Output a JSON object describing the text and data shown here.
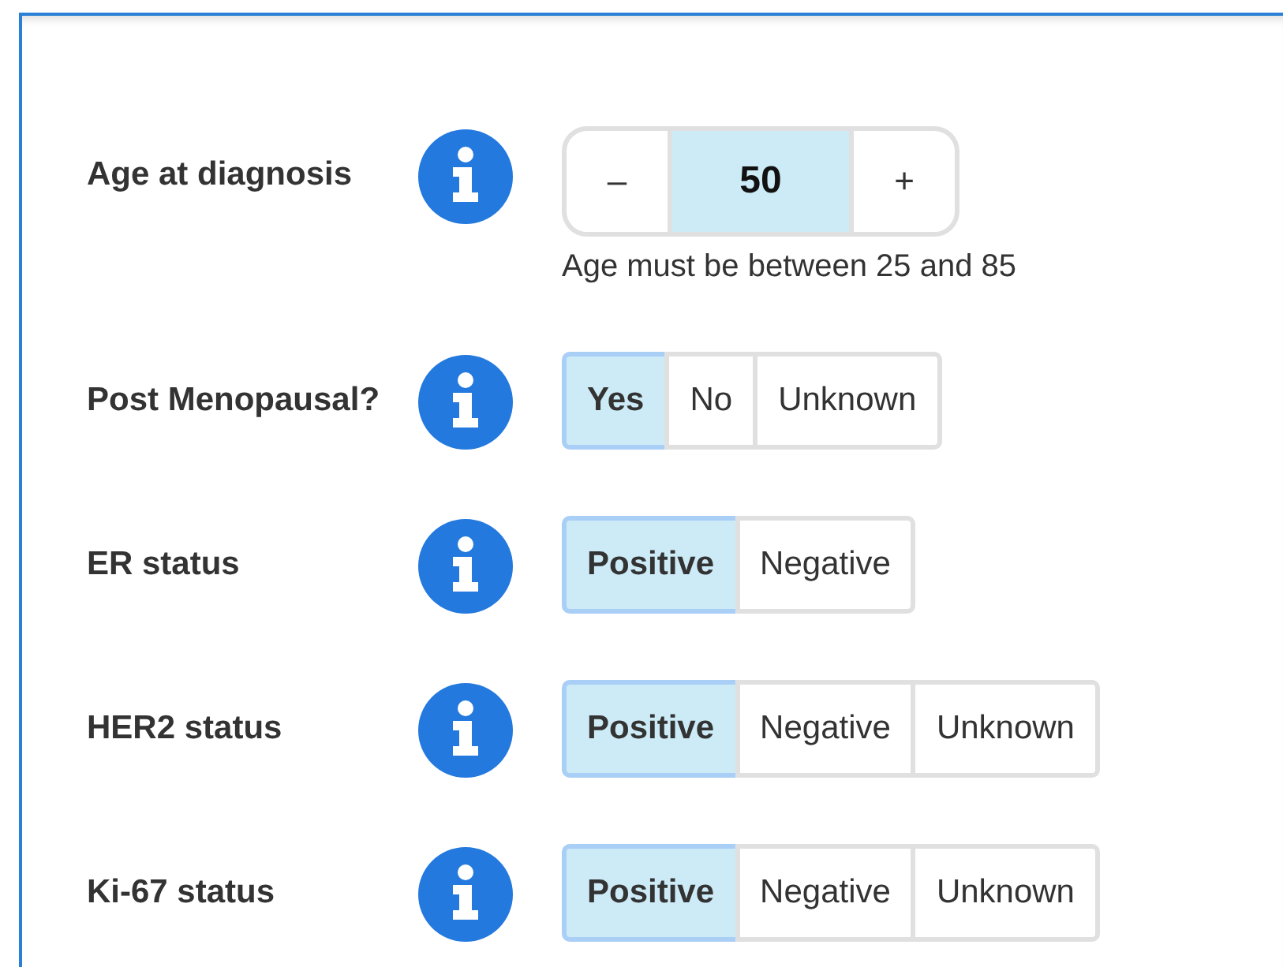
{
  "fields": [
    {
      "kind": "stepper",
      "label": "Age at diagnosis",
      "decrement": "–",
      "value": "50",
      "increment": "+",
      "hint": "Age must be between 25 and 85"
    },
    {
      "kind": "choice",
      "label": "Post Menopausal?",
      "options": [
        {
          "label": "Yes",
          "selected": true
        },
        {
          "label": "No",
          "selected": false
        },
        {
          "label": "Unknown",
          "selected": false
        }
      ]
    },
    {
      "kind": "choice",
      "label": "ER status",
      "options": [
        {
          "label": "Positive",
          "selected": true
        },
        {
          "label": "Negative",
          "selected": false
        }
      ]
    },
    {
      "kind": "choice",
      "label": "HER2 status",
      "options": [
        {
          "label": "Positive",
          "selected": true
        },
        {
          "label": "Negative",
          "selected": false
        },
        {
          "label": "Unknown",
          "selected": false
        }
      ]
    },
    {
      "kind": "choice",
      "label": "Ki-67 status",
      "options": [
        {
          "label": "Positive",
          "selected": true
        },
        {
          "label": "Negative",
          "selected": false
        },
        {
          "label": "Unknown",
          "selected": false
        }
      ]
    }
  ]
}
